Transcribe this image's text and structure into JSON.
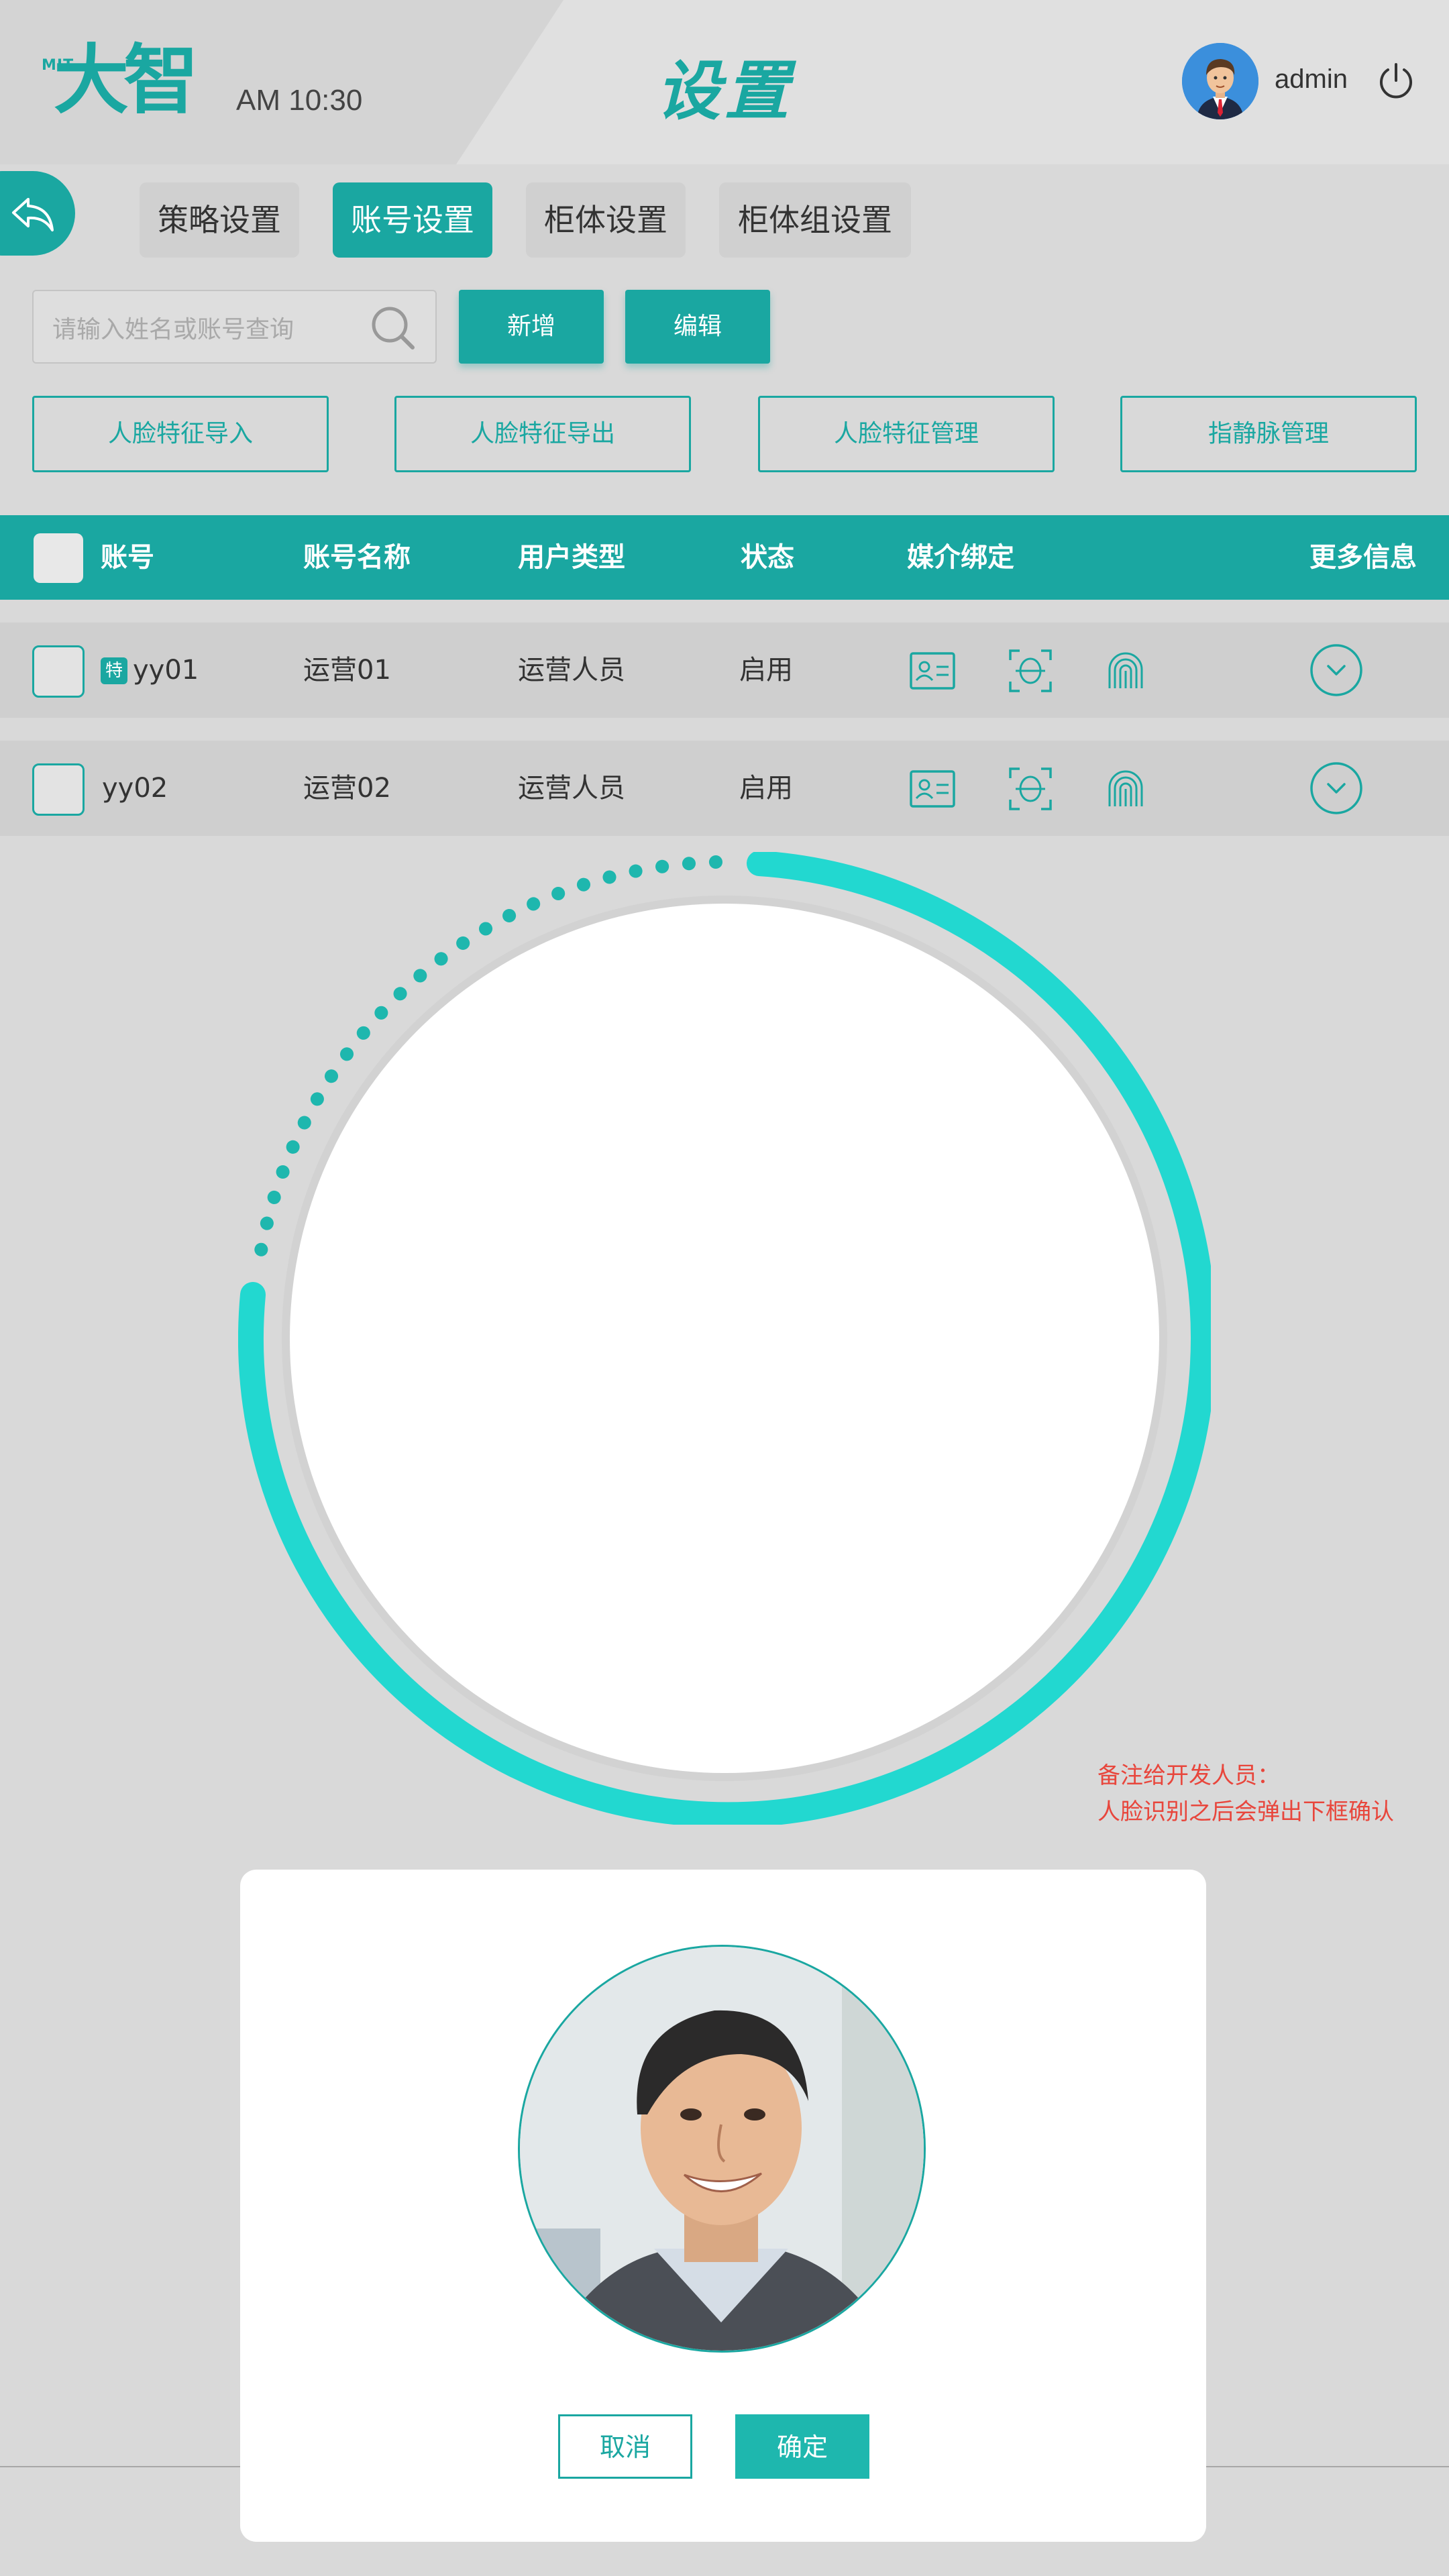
{
  "header": {
    "logo_prefix": "MIT",
    "logo_text": "大智",
    "time": "AM 10:30",
    "title": "设置",
    "username": "admin"
  },
  "tabs": [
    {
      "label": "策略设置",
      "active": false
    },
    {
      "label": "账号设置",
      "active": true
    },
    {
      "label": "柜体设置",
      "active": false
    },
    {
      "label": "柜体组设置",
      "active": false
    }
  ],
  "search": {
    "placeholder": "请输入姓名或账号查询"
  },
  "actions": {
    "add": "新增",
    "edit": "编辑"
  },
  "face_actions": [
    "人脸特征导入",
    "人脸特征导出",
    "人脸特征管理",
    "指静脉管理"
  ],
  "table": {
    "columns": [
      "账号",
      "账号名称",
      "用户类型",
      "状态",
      "媒介绑定",
      "更多信息"
    ],
    "rows": [
      {
        "badge": "特",
        "account": "yy01",
        "name": "运营01",
        "type": "运营人员",
        "status": "启用"
      },
      {
        "badge": "",
        "account": "yy02",
        "name": "运营02",
        "type": "运营人员",
        "status": "启用"
      }
    ]
  },
  "dev_note": [
    "备注给开发人员：",
    "人脸识别之后会弹出下框确认"
  ],
  "dialog": {
    "cancel": "取消",
    "confirm": "确定"
  },
  "colors": {
    "accent": "#1aa7a1",
    "ring": "#22d8d0",
    "note": "#e8463c"
  },
  "icons": [
    "back-icon",
    "search-icon",
    "power-icon",
    "id-card-icon",
    "face-scan-icon",
    "fingerprint-icon",
    "chevron-down-icon"
  ]
}
